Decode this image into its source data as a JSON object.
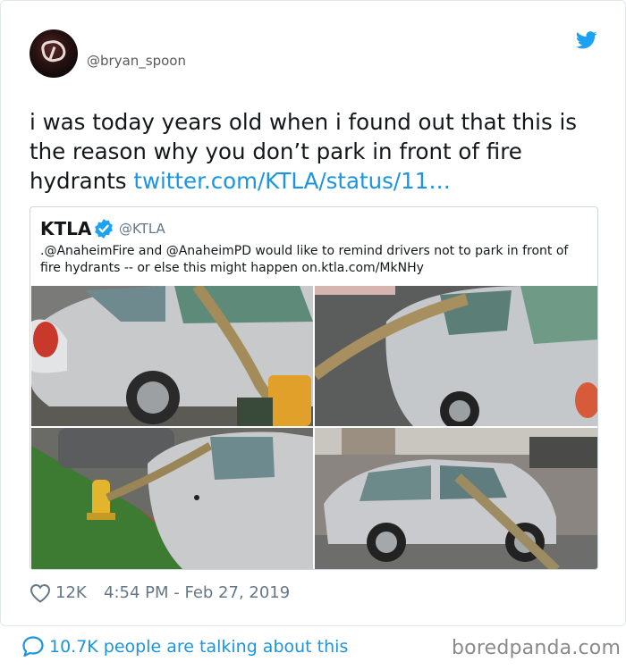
{
  "tweet": {
    "handle": "@bryan_spoon",
    "text_plain": "i was today years old when i found out that this is the reason why you don’t park in front of fire hydrants ",
    "text_link": "twitter.com/KTLA/status/11…",
    "likes": "12K",
    "timestamp": "4:54 PM - Feb 27, 2019"
  },
  "quoted_tweet": {
    "name": "KTLA",
    "handle": "@KTLA",
    "text": ".@AnaheimFire and @AnaheimPD would like to remind drivers not to park in front of fire hydrants -- or else this might happen on.ktla.com/MkNHy"
  },
  "bottom_bar": {
    "talking": "10.7K people are talking about this",
    "watermark": "boredpanda.com"
  },
  "icons": {
    "twitter": "twitter-bird-icon",
    "verified": "verified-badge-icon",
    "like": "heart-icon",
    "reply": "speech-bubble-icon"
  },
  "colors": {
    "link": "#1b95e0",
    "verified": "#1da1f2",
    "text": "#14171a",
    "secondary": "#657786"
  }
}
